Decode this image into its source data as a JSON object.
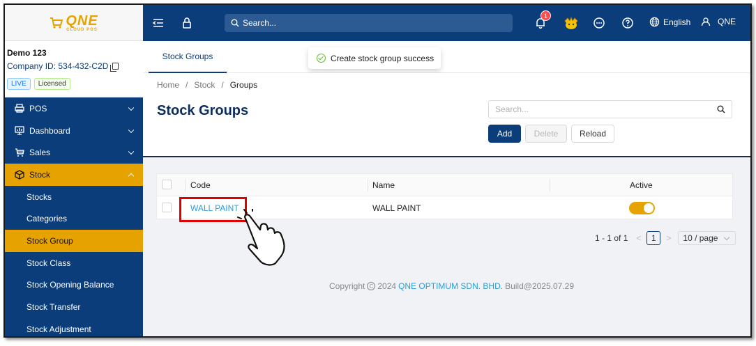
{
  "brand": {
    "logo_main": "QNE",
    "logo_sub": "CLOUD POS"
  },
  "company": {
    "name": "Demo 123",
    "id_text": "Company ID: 534-432-C2D",
    "tags": [
      "LIVE",
      "Licensed"
    ]
  },
  "sidebar": {
    "menu": [
      {
        "label": "POS",
        "icon": "printer-icon"
      },
      {
        "label": "Dashboard",
        "icon": "dashboard-icon"
      },
      {
        "label": "Sales",
        "icon": "cart-icon"
      },
      {
        "label": "Stock",
        "icon": "box-icon"
      }
    ],
    "submenu": [
      "Stocks",
      "Categories",
      "Stock Group",
      "Stock Class",
      "Stock Opening Balance",
      "Stock Transfer",
      "Stock Adjustment"
    ]
  },
  "topbar": {
    "search_placeholder": "Search...",
    "notification_count": "1",
    "language": "English",
    "user": "QNE"
  },
  "tabs": {
    "active": "Stock Groups"
  },
  "toast": {
    "message": "Create stock group success"
  },
  "breadcrumb": {
    "home": "Home",
    "sep": "/",
    "stock": "Stock",
    "current": "Groups"
  },
  "page": {
    "title": "Stock Groups",
    "search_placeholder": "Search..."
  },
  "actions": {
    "add": "Add",
    "delete": "Delete",
    "reload": "Reload"
  },
  "table": {
    "columns": {
      "code": "Code",
      "name": "Name",
      "active": "Active"
    },
    "rows": [
      {
        "code": "WALL PAINT",
        "name": "WALL PAINT",
        "active": true
      }
    ]
  },
  "pagination": {
    "range": "1 - 1 of 1",
    "prev": "<",
    "page": "1",
    "next": ">",
    "page_size": "10 / page"
  },
  "footer": {
    "prefix": "Copyright",
    "year": "2024",
    "company": "QNE OPTIMUM SDN. BHD.",
    "build": "Build@2025.07.29"
  },
  "colors": {
    "primary": "#0b3d7b",
    "accent": "#e6a300",
    "link": "#2a9fd8",
    "highlight": "#e00000"
  }
}
